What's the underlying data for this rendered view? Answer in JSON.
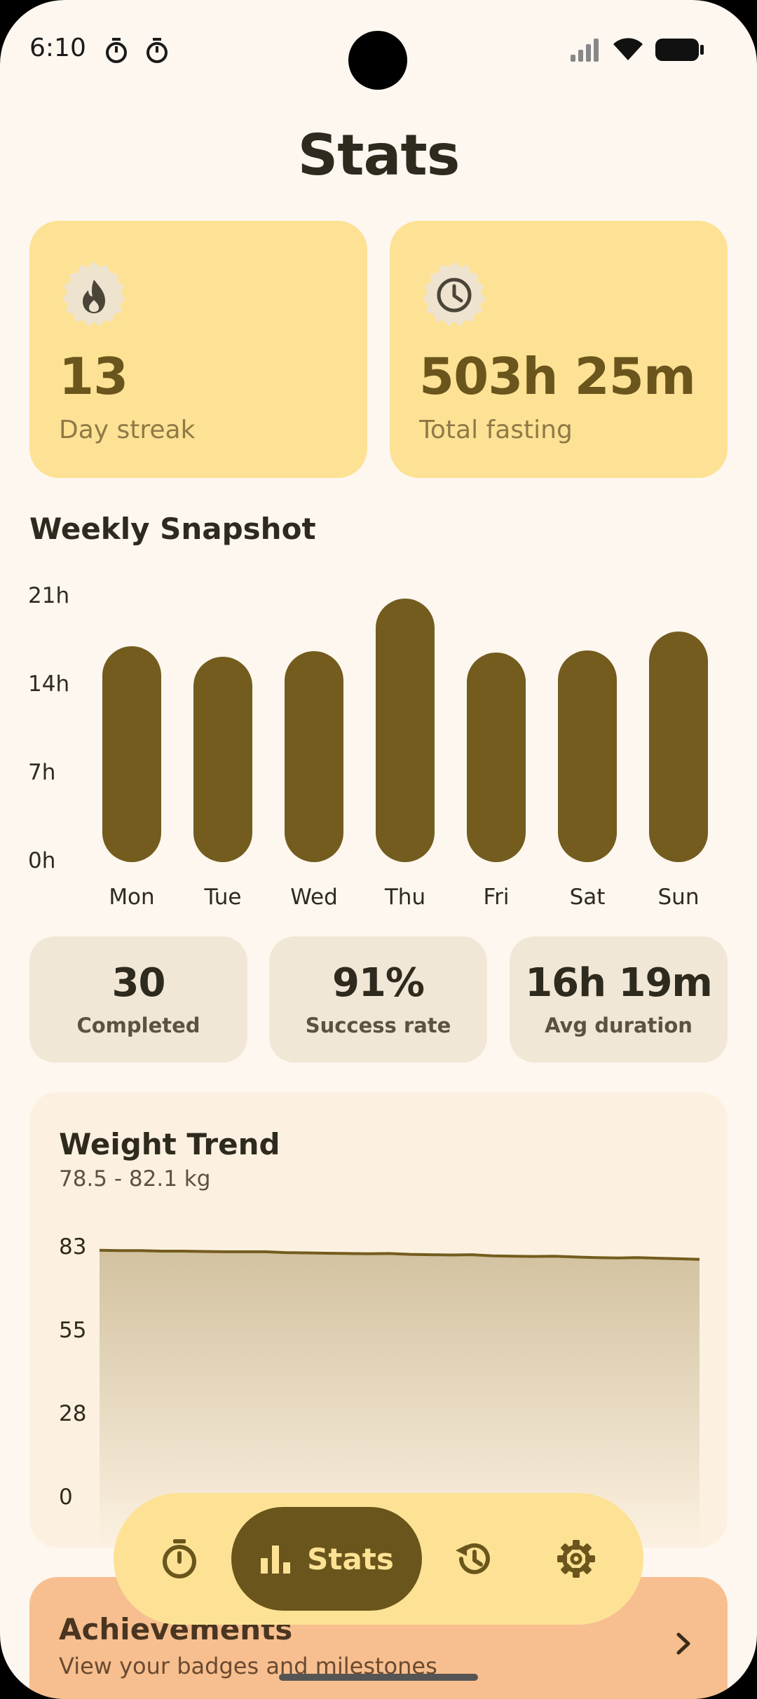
{
  "status_bar": {
    "time": "6:10"
  },
  "page": {
    "title": "Stats"
  },
  "cards": [
    {
      "icon": "flame-icon",
      "value": "13",
      "label": "Day streak"
    },
    {
      "icon": "clock-icon",
      "value": "503h 25m",
      "label": "Total fasting"
    }
  ],
  "weekly": {
    "title": "Weekly Snapshot",
    "y_ticks": [
      "21h",
      "14h",
      "7h",
      "0h"
    ]
  },
  "chart_data": [
    {
      "type": "bar",
      "title": "Weekly Snapshot",
      "categories": [
        "Mon",
        "Tue",
        "Wed",
        "Thu",
        "Fri",
        "Sat",
        "Sun"
      ],
      "values": [
        17.1,
        16.3,
        16.7,
        20.9,
        16.6,
        16.8,
        18.3
      ],
      "yunit": "h",
      "ylim": [
        0,
        21
      ]
    },
    {
      "type": "area",
      "title": "Weight Trend",
      "subtitle": "78.5 - 82.1 kg",
      "x": [
        1,
        2,
        3,
        4,
        5,
        6,
        7,
        8,
        9,
        10,
        11,
        12,
        13,
        14,
        15,
        16,
        17,
        18,
        19,
        20,
        21,
        22,
        23,
        24,
        25,
        26,
        27,
        28,
        29,
        30
      ],
      "values": [
        82.1,
        82.0,
        82.0,
        81.8,
        81.8,
        81.7,
        81.6,
        81.6,
        81.6,
        81.3,
        81.2,
        81.1,
        81.0,
        80.9,
        81.0,
        80.7,
        80.6,
        80.5,
        80.6,
        80.2,
        80.1,
        80.0,
        80.1,
        79.8,
        79.6,
        79.5,
        79.6,
        79.4,
        79.2,
        79.0
      ],
      "ylim": [
        0,
        83
      ],
      "y_ticks": [
        "83",
        "55",
        "28",
        "0"
      ]
    }
  ],
  "stats": [
    {
      "value": "30",
      "label": "Completed"
    },
    {
      "value": "91%",
      "label": "Success rate"
    },
    {
      "value": "16h 19m",
      "label": "Avg duration"
    }
  ],
  "weight": {
    "title": "Weight Trend",
    "subtitle": "78.5 - 82.1 kg",
    "y_ticks": [
      "83",
      "55",
      "28",
      "0"
    ]
  },
  "achievements": {
    "title": "Achievements",
    "subtitle": "View your badges and milestones"
  },
  "nav": {
    "items": [
      {
        "icon": "timer-icon"
      },
      {
        "icon": "bar-chart-icon",
        "label": "Stats"
      },
      {
        "icon": "history-icon"
      },
      {
        "icon": "gear-icon"
      }
    ]
  },
  "colors": {
    "background": "#fdf7ef",
    "card": "#fde295",
    "accent": "#735c1e",
    "tile": "#f1e7d6",
    "achievements": "#f7bf8f"
  }
}
